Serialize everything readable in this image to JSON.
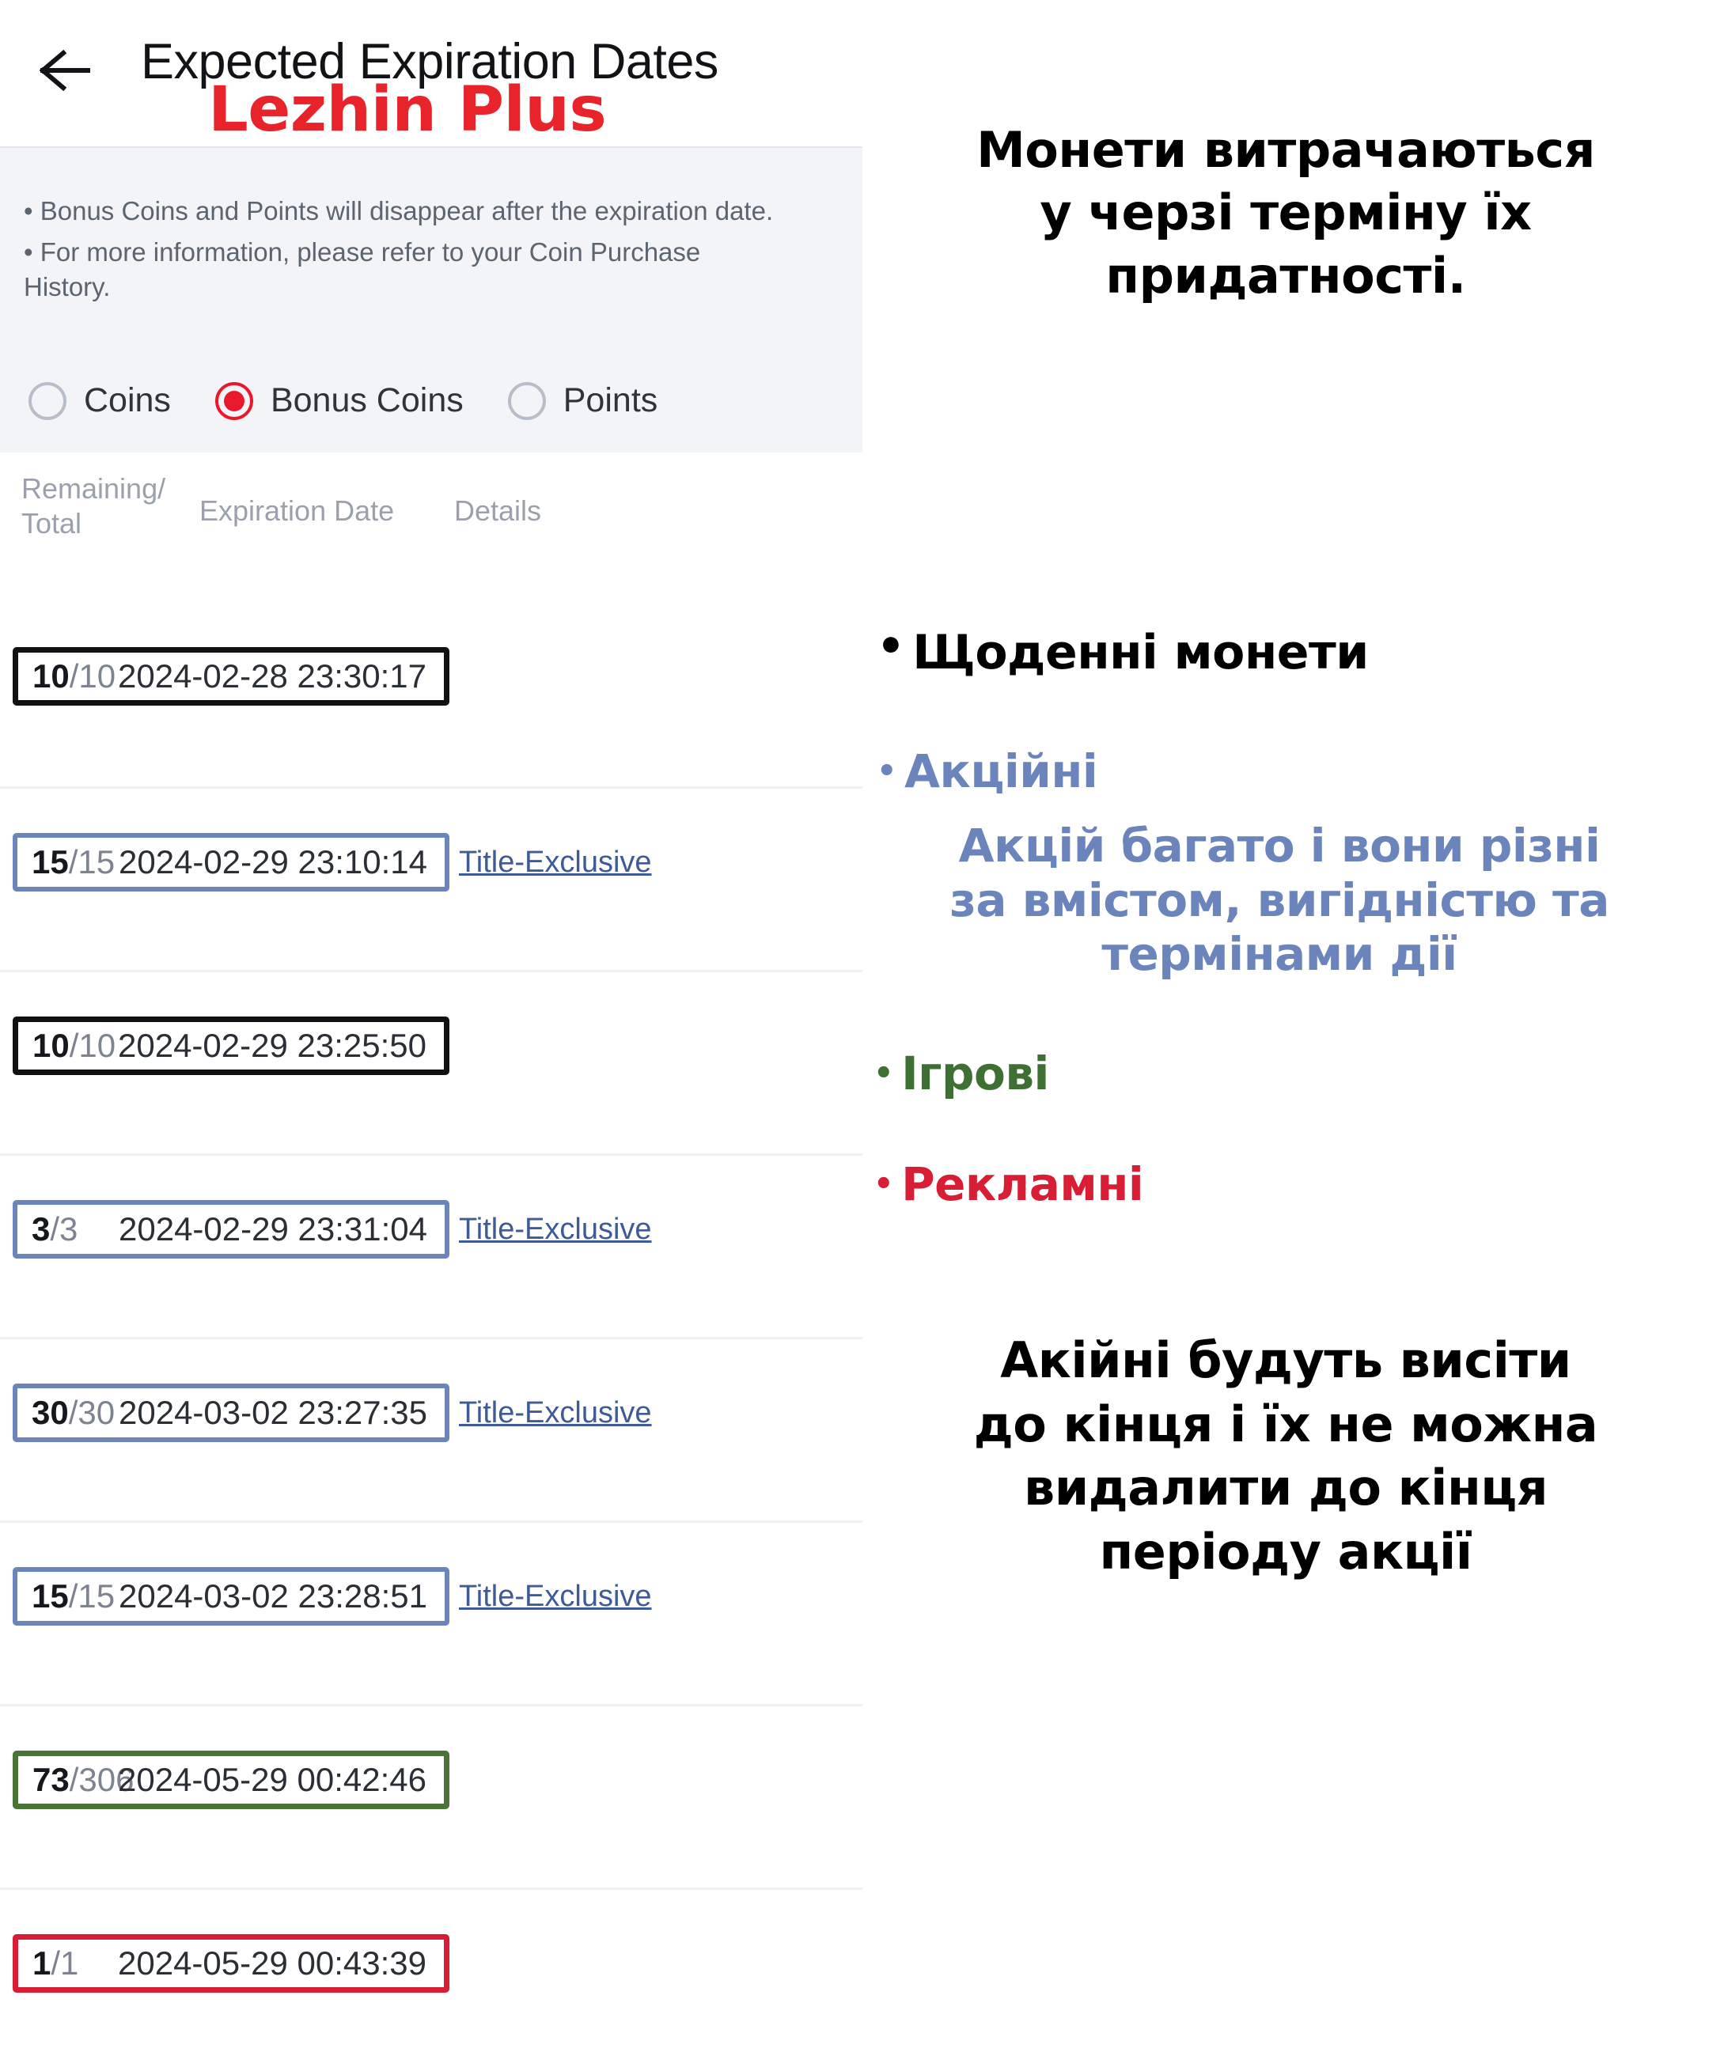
{
  "app": {
    "title": "Expected Expiration Dates",
    "back_icon": "arrow-left-icon",
    "watermark": "Lezhin Plus"
  },
  "notice": {
    "line1": "• Bonus Coins and Points will disappear after the expiration date.",
    "line2": "• For more information, please refer to your Coin Purchase History."
  },
  "filters": {
    "options": [
      {
        "label": "Coins",
        "selected": false
      },
      {
        "label": "Bonus Coins",
        "selected": true
      },
      {
        "label": "Points",
        "selected": false
      }
    ],
    "selected_color": "#e8192c"
  },
  "table": {
    "headers": {
      "remaining_total": "Remaining/\nTotal",
      "remaining_total_line1": "Remaining/",
      "remaining_total_line2": "Total",
      "expiration_date": "Expiration Date",
      "details": "Details"
    },
    "rows": [
      {
        "remaining": "10",
        "total": "/10",
        "date": "2024-02-28 23:30:17",
        "details": "",
        "highlight": "black"
      },
      {
        "remaining": "15",
        "total": "/15",
        "date": "2024-02-29 23:10:14",
        "details": "Title-Exclusive",
        "highlight": "blue"
      },
      {
        "remaining": "10",
        "total": "/10",
        "date": "2024-02-29 23:25:50",
        "details": "",
        "highlight": "black"
      },
      {
        "remaining": "3",
        "total": "/3",
        "date": "2024-02-29 23:31:04",
        "details": "Title-Exclusive",
        "highlight": "blue"
      },
      {
        "remaining": "30",
        "total": "/30",
        "date": "2024-03-02 23:27:35",
        "details": "Title-Exclusive",
        "highlight": "blue"
      },
      {
        "remaining": "15",
        "total": "/15",
        "date": "2024-03-02 23:28:51",
        "details": "Title-Exclusive",
        "highlight": "blue"
      },
      {
        "remaining": "73",
        "total": "/306",
        "date": "2024-05-29 00:42:46",
        "details": "",
        "highlight": "green"
      },
      {
        "remaining": "1",
        "total": "/1",
        "date": "2024-05-29 00:43:39",
        "details": "",
        "highlight": "red"
      }
    ],
    "highlight_colors": {
      "black": "#111111",
      "blue": "#6b84bc",
      "green": "#4a7337",
      "red": "#d81e35"
    }
  },
  "annotations": {
    "top_note_line1": "Монети витрачаються",
    "top_note_line2": "у черзі терміну їх",
    "top_note_line3": "придатності.",
    "bullets": [
      {
        "label": "Щоденні монети",
        "color": "#000000",
        "marker": "•"
      },
      {
        "label": "Акційні",
        "color": "#6b84bc",
        "marker": "•"
      },
      {
        "label": "Ігрові",
        "color": "#3d7032",
        "marker": "•"
      },
      {
        "label": "Рекламні",
        "color": "#d81e35",
        "marker": "•"
      }
    ],
    "promo_note_line1": "Акцій багато і вони різні",
    "promo_note_line2": "за вмістом, вигідністю та",
    "promo_note_line3": "термінами дії",
    "bottom_note_line1": "Акійні будуть висіти",
    "bottom_note_line2": "до кінця і їх не можна",
    "bottom_note_line3": "видалити до кінця",
    "bottom_note_line4": "періоду акції"
  }
}
